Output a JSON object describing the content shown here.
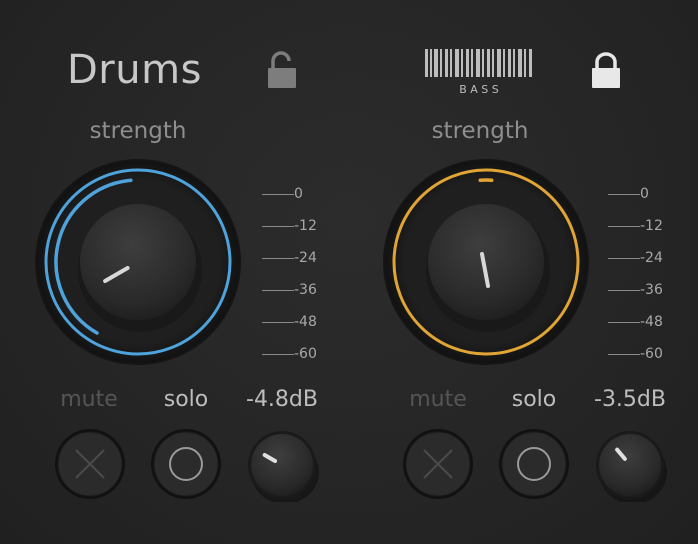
{
  "channels": [
    {
      "id": "drums",
      "title": "Drums",
      "lock_state": "unlocked",
      "strength_label": "strength",
      "strength_value": 0.38,
      "ring_color": "#4fa3dc",
      "meter_labels": [
        "0",
        "-12",
        "-24",
        "-36",
        "-48",
        "-60"
      ],
      "mute_label": "mute",
      "solo_label": "solo",
      "gain_label": "-4.8dB"
    },
    {
      "id": "bass",
      "logo_text": "B A S S",
      "lock_state": "locked",
      "strength_label": "strength",
      "strength_value": 0.5,
      "ring_color": "#e0a534",
      "meter_labels": [
        "0",
        "-12",
        "-24",
        "-36",
        "-48",
        "-60"
      ],
      "mute_label": "mute",
      "solo_label": "solo",
      "gain_label": "-3.5dB"
    }
  ],
  "icons": {
    "lock_open": "unlocked-padlock-icon",
    "lock_closed": "locked-padlock-icon",
    "mute": "x-icon",
    "solo": "circle-icon"
  }
}
